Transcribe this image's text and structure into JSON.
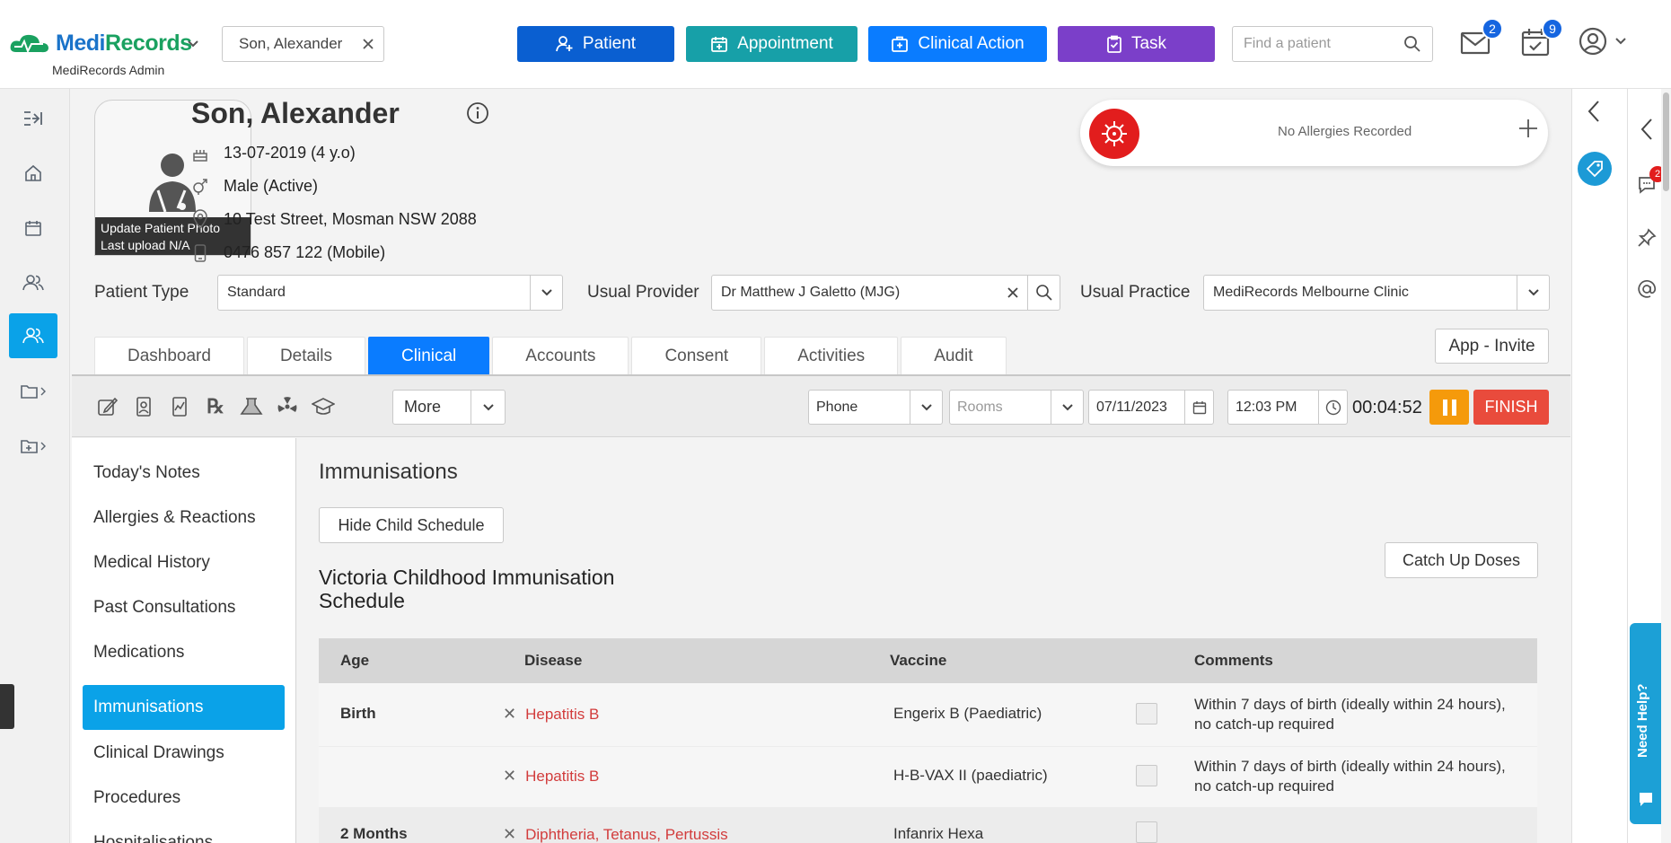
{
  "app": {
    "brand_a": "Medi",
    "brand_b": "Records",
    "subtitle": "MediRecords Admin"
  },
  "header": {
    "patient_chip": "Son, Alexander",
    "buttons": {
      "patient": "Patient",
      "appointment": "Appointment",
      "clinical_action": "Clinical Action",
      "task": "Task"
    },
    "find_placeholder": "Find a patient",
    "mail_badge": "2",
    "tasks_badge": "9"
  },
  "colors": {
    "patient_btn": "#0a5fd1",
    "appointment_btn": "#17a0a8",
    "clinical_btn": "#0a7cff",
    "task_btn": "#7b3fc9",
    "accent": "#0aa2e8",
    "allergy_red": "#e21d1d",
    "finish": "#e94b3c",
    "pause": "#f59a0b"
  },
  "patient": {
    "name": "Son, Alexander",
    "dob": "13-07-2019 (4 y.o)",
    "gender_status": "Male (Active)",
    "address": "10 Test Street, Mosman NSW 2088",
    "phone": "0476 857 122 (Mobile)",
    "photo_caption_1": "Update Patient Photo",
    "photo_caption_2": "Last upload N/A"
  },
  "allergies": {
    "text": "No Allergies Recorded",
    "add_icon": "plus-icon"
  },
  "fields": {
    "patient_type_label": "Patient Type",
    "patient_type_value": "Standard",
    "usual_provider_label": "Usual Provider",
    "usual_provider_value": "Dr Matthew J Galetto (MJG)",
    "usual_practice_label": "Usual Practice",
    "usual_practice_value": "MediRecords Melbourne Clinic"
  },
  "tabs": [
    "Dashboard",
    "Details",
    "Clinical",
    "Accounts",
    "Consent",
    "Activities",
    "Audit"
  ],
  "app_invite": "App - Invite",
  "toolbar": {
    "more": "More",
    "contact_type": "Phone",
    "rooms_placeholder": "Rooms",
    "date": "07/11/2023",
    "time": "12:03 PM",
    "timer": "00:04:52",
    "finish": "FINISH"
  },
  "sidemenu": [
    "Today's Notes",
    "Allergies & Reactions",
    "Medical History",
    "Past Consultations",
    "Medications",
    "Immunisations",
    "Clinical Drawings",
    "Procedures",
    "Hospitalisations"
  ],
  "immunisations": {
    "title": "Immunisations",
    "hide_child_schedule": "Hide Child Schedule",
    "catch_up": "Catch Up Doses",
    "schedule_title": "Victoria Childhood Immunisation Schedule",
    "columns": {
      "age": "Age",
      "disease": "Disease",
      "vaccine": "Vaccine",
      "comments": "Comments"
    },
    "rows": [
      {
        "age": "Birth",
        "disease": "Hepatitis B",
        "vaccine": "Engerix B (Paediatric)",
        "comment": "Within 7 days of birth (ideally within 24 hours), no catch-up required"
      },
      {
        "age": "",
        "disease": "Hepatitis B",
        "vaccine": "H-B-VAX II (paediatric)",
        "comment": "Within 7 days of birth (ideally within 24 hours), no catch-up required"
      },
      {
        "age": "2 Months",
        "disease": "Diphtheria, Tetanus, Pertussis",
        "vaccine": "Infanrix Hexa",
        "comment": ""
      }
    ]
  },
  "right_panel": {
    "messages_badge": "2",
    "help": "Need Help?"
  }
}
